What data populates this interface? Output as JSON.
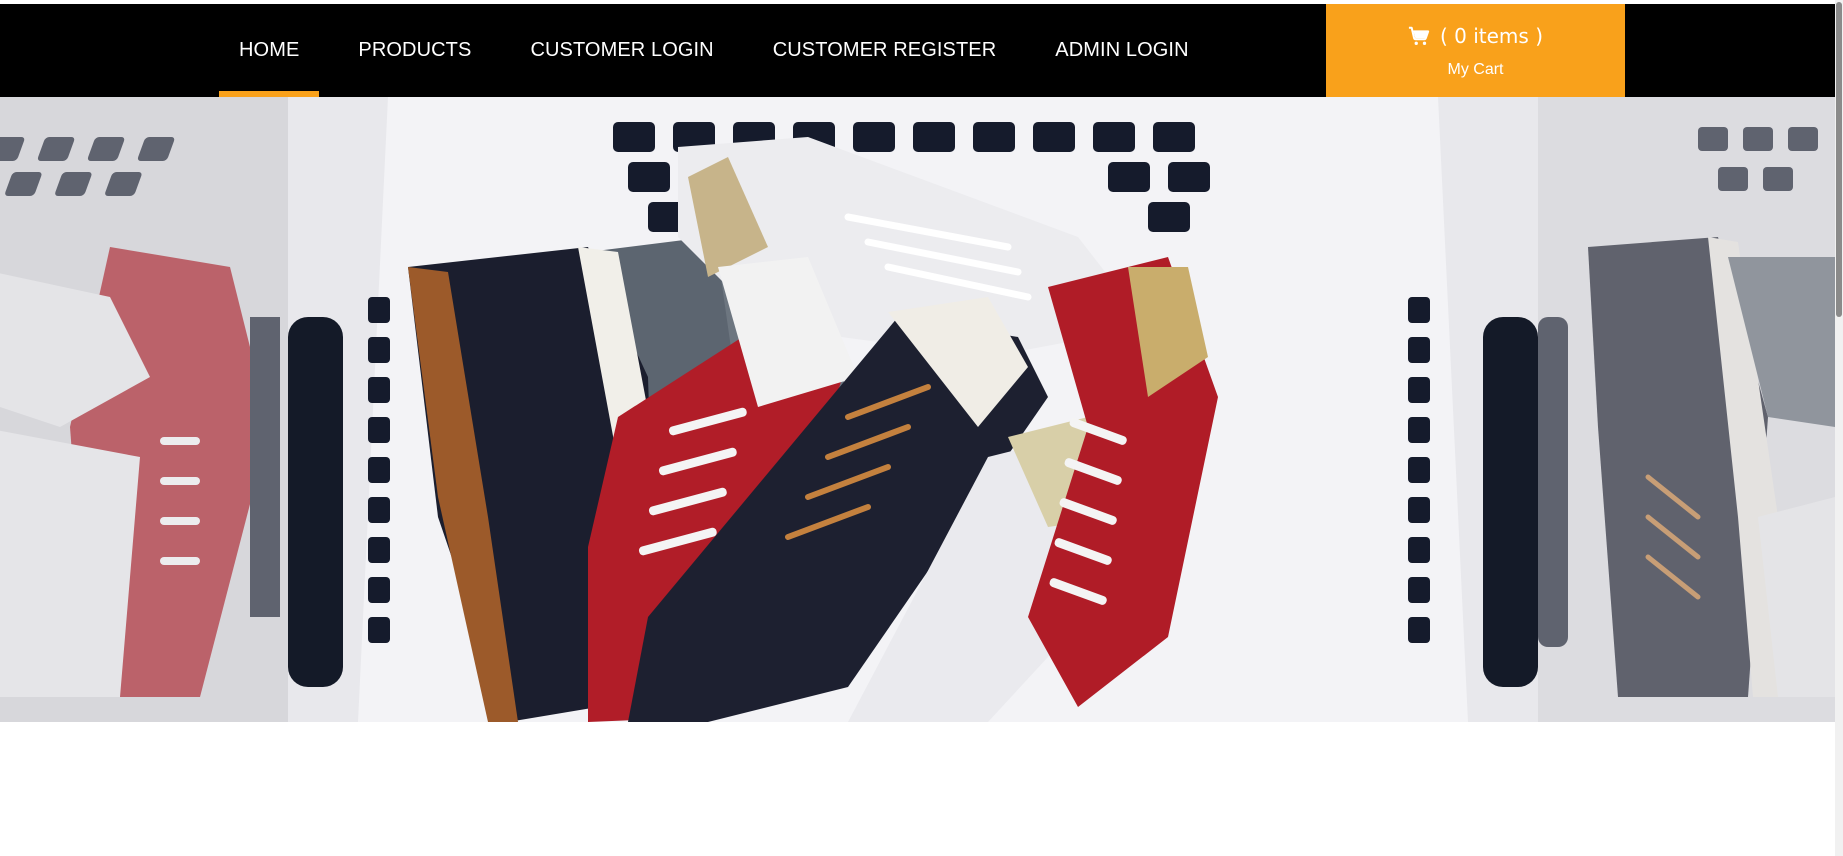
{
  "nav": {
    "items": [
      {
        "label": "HOME",
        "active": true
      },
      {
        "label": "PRODUCTS",
        "active": false
      },
      {
        "label": "CUSTOMER LOGIN",
        "active": false
      },
      {
        "label": "CUSTOMER REGISTER",
        "active": false
      },
      {
        "label": "ADMIN LOGIN",
        "active": false
      }
    ]
  },
  "cart": {
    "items_text": "( 0 items )",
    "label": "My Cart",
    "icon": "shopping-cart-icon"
  },
  "hero": {
    "image": "sneakers-in-laundry-basket-photo"
  },
  "colors": {
    "nav_bg": "#000000",
    "accent": "#f9a11b",
    "nav_text": "#ffffff"
  }
}
